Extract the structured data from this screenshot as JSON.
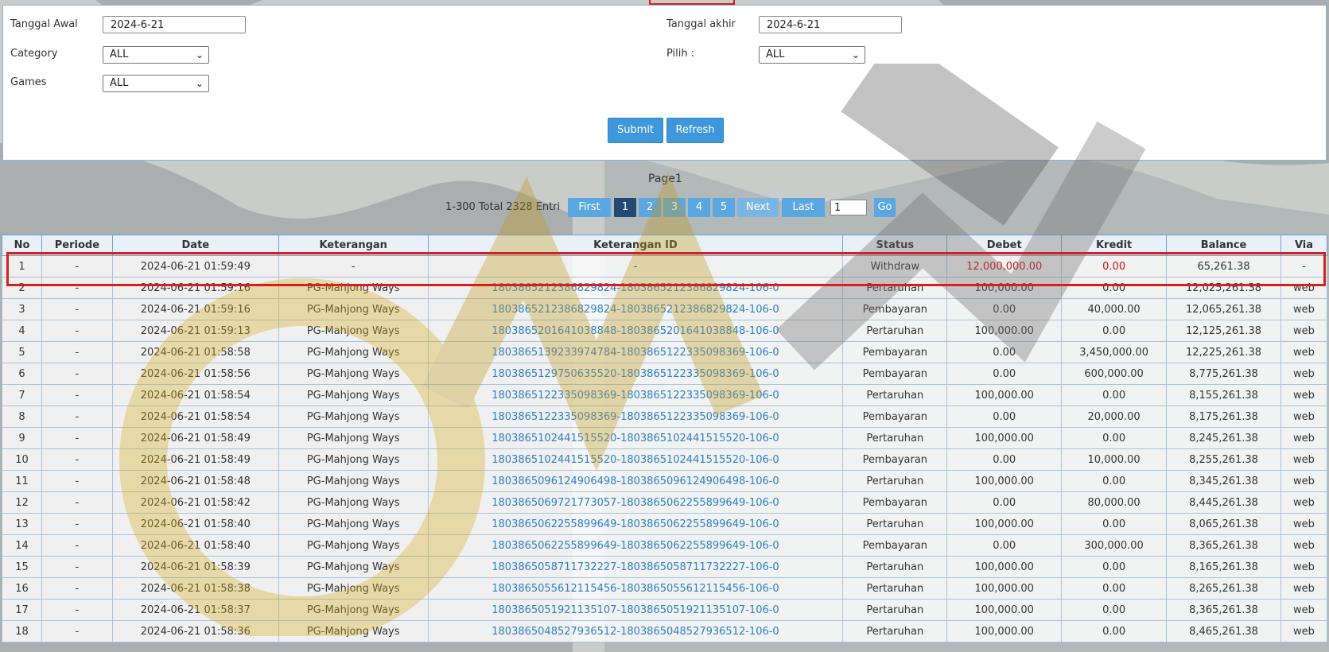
{
  "filters": {
    "start_date_label": "Tanggal Awal",
    "start_date_value": "2024-6-21",
    "end_date_label": "Tanggal akhir",
    "end_date_value": "2024-6-21",
    "category_label": "Category",
    "category_value": "ALL",
    "pilih_label": "Pilih :",
    "pilih_value": "ALL",
    "games_label": "Games",
    "games_value": "ALL",
    "submit_label": "Submit",
    "refresh_label": "Refresh"
  },
  "pagination": {
    "page_title": "Page1",
    "entry_info": "1-300 Total 2328 Entri",
    "first_label": "First",
    "pages": [
      "1",
      "2",
      "3",
      "4",
      "5"
    ],
    "next_label": "Next",
    "last_label": "Last",
    "page_input_value": "1",
    "go_label": "Go"
  },
  "table": {
    "headers": [
      "No",
      "Periode",
      "Date",
      "Keterangan",
      "Keterangan ID",
      "Status",
      "Debet",
      "Kredit",
      "Balance",
      "Via"
    ],
    "rows": [
      [
        "1",
        "-",
        "2024-06-21 01:59:49",
        "-",
        "-",
        "Withdraw",
        "12,000,000.00",
        "0.00",
        "65,261.38",
        "-"
      ],
      [
        "2",
        "-",
        "2024-06-21 01:59:16",
        "PG-Mahjong Ways",
        "1803865212386829824-1803865212386829824-106-0",
        "Pertaruhan",
        "100,000.00",
        "0.00",
        "12,025,261.38",
        "web"
      ],
      [
        "3",
        "-",
        "2024-06-21 01:59:16",
        "PG-Mahjong Ways",
        "1803865212386829824-1803865212386829824-106-0",
        "Pembayaran",
        "0.00",
        "40,000.00",
        "12,065,261.38",
        "web"
      ],
      [
        "4",
        "-",
        "2024-06-21 01:59:13",
        "PG-Mahjong Ways",
        "1803865201641038848-1803865201641038848-106-0",
        "Pertaruhan",
        "100,000.00",
        "0.00",
        "12,125,261.38",
        "web"
      ],
      [
        "5",
        "-",
        "2024-06-21 01:58:58",
        "PG-Mahjong Ways",
        "1803865139233974784-1803865122335098369-106-0",
        "Pembayaran",
        "0.00",
        "3,450,000.00",
        "12,225,261.38",
        "web"
      ],
      [
        "6",
        "-",
        "2024-06-21 01:58:56",
        "PG-Mahjong Ways",
        "1803865129750635520-1803865122335098369-106-0",
        "Pembayaran",
        "0.00",
        "600,000.00",
        "8,775,261.38",
        "web"
      ],
      [
        "7",
        "-",
        "2024-06-21 01:58:54",
        "PG-Mahjong Ways",
        "1803865122335098369-1803865122335098369-106-0",
        "Pertaruhan",
        "100,000.00",
        "0.00",
        "8,155,261.38",
        "web"
      ],
      [
        "8",
        "-",
        "2024-06-21 01:58:54",
        "PG-Mahjong Ways",
        "1803865122335098369-1803865122335098369-106-0",
        "Pembayaran",
        "0.00",
        "20,000.00",
        "8,175,261.38",
        "web"
      ],
      [
        "9",
        "-",
        "2024-06-21 01:58:49",
        "PG-Mahjong Ways",
        "1803865102441515520-1803865102441515520-106-0",
        "Pertaruhan",
        "100,000.00",
        "0.00",
        "8,245,261.38",
        "web"
      ],
      [
        "10",
        "-",
        "2024-06-21 01:58:49",
        "PG-Mahjong Ways",
        "1803865102441515520-1803865102441515520-106-0",
        "Pembayaran",
        "0.00",
        "10,000.00",
        "8,255,261.38",
        "web"
      ],
      [
        "11",
        "-",
        "2024-06-21 01:58:48",
        "PG-Mahjong Ways",
        "1803865096124906498-1803865096124906498-106-0",
        "Pertaruhan",
        "100,000.00",
        "0.00",
        "8,345,261.38",
        "web"
      ],
      [
        "12",
        "-",
        "2024-06-21 01:58:42",
        "PG-Mahjong Ways",
        "1803865069721773057-1803865062255899649-106-0",
        "Pembayaran",
        "0.00",
        "80,000.00",
        "8,445,261.38",
        "web"
      ],
      [
        "13",
        "-",
        "2024-06-21 01:58:40",
        "PG-Mahjong Ways",
        "1803865062255899649-1803865062255899649-106-0",
        "Pertaruhan",
        "100,000.00",
        "0.00",
        "8,065,261.38",
        "web"
      ],
      [
        "14",
        "-",
        "2024-06-21 01:58:40",
        "PG-Mahjong Ways",
        "1803865062255899649-1803865062255899649-106-0",
        "Pembayaran",
        "0.00",
        "300,000.00",
        "8,365,261.38",
        "web"
      ],
      [
        "15",
        "-",
        "2024-06-21 01:58:39",
        "PG-Mahjong Ways",
        "1803865058711732227-1803865058711732227-106-0",
        "Pertaruhan",
        "100,000.00",
        "0.00",
        "8,165,261.38",
        "web"
      ],
      [
        "16",
        "-",
        "2024-06-21 01:58:38",
        "PG-Mahjong Ways",
        "1803865055612115456-1803865055612115456-106-0",
        "Pertaruhan",
        "100,000.00",
        "0.00",
        "8,265,261.38",
        "web"
      ],
      [
        "17",
        "-",
        "2024-06-21 01:58:37",
        "PG-Mahjong Ways",
        "1803865051921135107-1803865051921135107-106-0",
        "Pertaruhan",
        "100,000.00",
        "0.00",
        "8,365,261.38",
        "web"
      ],
      [
        "18",
        "-",
        "2024-06-21 01:58:36",
        "PG-Mahjong Ways",
        "1803865048527936512-1803865048527936512-106-0",
        "Pertaruhan",
        "100,000.00",
        "0.00",
        "8,465,261.38",
        "web"
      ]
    ]
  },
  "colors": {
    "button_blue": "#3e97db",
    "active_page": "#234a72",
    "link_blue": "#2f7fc6",
    "debit_red": "#d40f12",
    "highlight_red": "#d91e1e"
  }
}
